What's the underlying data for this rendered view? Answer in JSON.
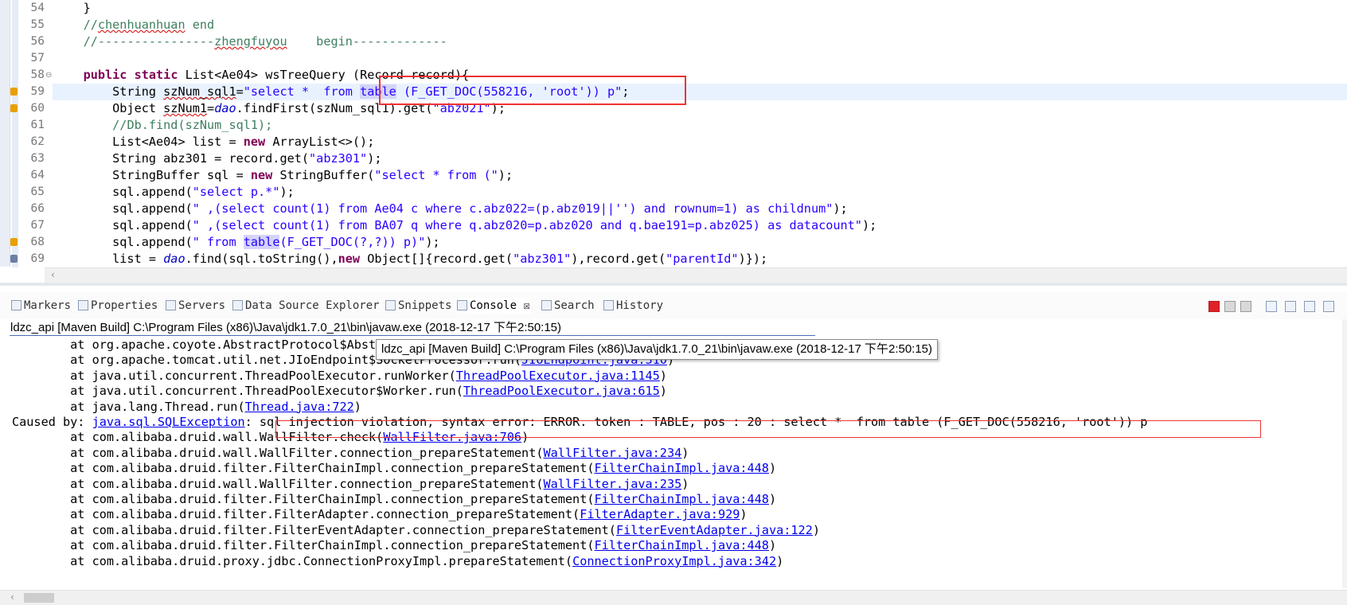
{
  "editor": {
    "lines": [
      {
        "n": "54",
        "html": "    }"
      },
      {
        "n": "55",
        "html": "    <span class=\"cmt\">//<span class=\"squig\">chenhuanhuan</span> end</span>"
      },
      {
        "n": "56",
        "html": "    <span class=\"cmt\">//----------------<span class=\"squig\">zhengfuyou</span>    begin-------------</span>"
      },
      {
        "n": "57",
        "html": ""
      },
      {
        "n": "58",
        "html": "    <span class=\"kw\">public</span> <span class=\"kw\">static</span> List&lt;Ae04&gt; wsTreeQuery (Record record){"
      },
      {
        "n": "59",
        "html": "        String <span class=\"squig\">szNum_sql1</span>=<span class=\"str\">\"select *  from <span class=\"occ\">table</span> (F_GET_DOC(558216, 'root')) p\"</span>;"
      },
      {
        "n": "60",
        "html": "        Object <span class=\"squig\">szNum1</span>=<span class=\"fld\">dao</span>.findFirst(szNum_sql1).get(<span class=\"str\">\"abz021\"</span>);"
      },
      {
        "n": "61",
        "html": "        <span class=\"cmt\">//Db.find(szNum_sql1);</span>"
      },
      {
        "n": "62",
        "html": "        List&lt;Ae04&gt; list = <span class=\"kw\">new</span> ArrayList&lt;&gt;();"
      },
      {
        "n": "63",
        "html": "        String abz301 = record.get(<span class=\"str\">\"abz301\"</span>);"
      },
      {
        "n": "64",
        "html": "        StringBuffer sql = <span class=\"kw\">new</span> StringBuffer(<span class=\"str\">\"select * from (\"</span>);"
      },
      {
        "n": "65",
        "html": "        sql.append(<span class=\"str\">\"select p.*\"</span>);"
      },
      {
        "n": "66",
        "html": "        sql.append(<span class=\"str\">\" ,(select count(1) from Ae04 c where c.abz022=(p.abz019||'') and rownum=1) as childnum\"</span>);"
      },
      {
        "n": "67",
        "html": "        sql.append(<span class=\"str\">\" ,(select count(1) from BA07 q where q.abz020=p.abz020 and q.bae191=p.abz025) as datacount\"</span>);"
      },
      {
        "n": "68",
        "html": "        sql.append(<span class=\"str\">\" from <span class=\"occ\">table</span>(F_GET_DOC(?,?)) p)\"</span>);"
      },
      {
        "n": "69",
        "html": "        list = <span class=\"fld\">dao</span>.find(sql.toString(),<span class=\"kw\">new</span> Object[]{record.get(<span class=\"str\">\"abz301\"</span>),record.get(<span class=\"str\">\"parentId\"</span>)});"
      }
    ],
    "fold_marker": "⊖",
    "scroll_left_arrow": "‹"
  },
  "tabs": [
    {
      "label": "Markers"
    },
    {
      "label": "Properties"
    },
    {
      "label": "Servers"
    },
    {
      "label": "Data Source Explorer"
    },
    {
      "label": "Snippets"
    },
    {
      "label": "Console ☒",
      "active": true
    },
    {
      "label": "Search"
    },
    {
      "label": "History"
    }
  ],
  "console": {
    "title": "ldzc_api [Maven Build] C:\\Program Files (x86)\\Java\\jdk1.7.0_21\\bin\\javaw.exe (2018-12-17 下午2:50:15)",
    "tooltip": "ldzc_api [Maven Build] C:\\Program Files (x86)\\Java\\jdk1.7.0_21\\bin\\javaw.exe (2018-12-17 下午2:50:15)",
    "lines": [
      {
        "pre": "        at org.apache.coyote.AbstractProtocol$AbstractConnectionHandler.process(",
        "link": "AbstractProtocol.java:595",
        "post": ")"
      },
      {
        "pre": "        at org.apache.tomcat.util.net.JIoEndpoint$SocketProcessor.run(",
        "link": "JIoEndpoint.java:310",
        "post": ")"
      },
      {
        "pre": "        at java.util.concurrent.ThreadPoolExecutor.runWorker(",
        "link": "ThreadPoolExecutor.java:1145",
        "post": ")"
      },
      {
        "pre": "        at java.util.concurrent.ThreadPoolExecutor$Worker.run(",
        "link": "ThreadPoolExecutor.java:615",
        "post": ")"
      },
      {
        "pre": "        at java.lang.Thread.run(",
        "link": "Thread.java:722",
        "post": ")"
      },
      {
        "pre": "Caused by: ",
        "link": "java.sql.SQLException",
        "post": ": sql injection violation, syntax error: ERROR. token : TABLE, pos : 20 : select *  from table (F_GET_DOC(558216, 'root')) p"
      },
      {
        "pre": "        at com.alibaba.druid.wall.WallFilter.check(",
        "link": "WallFilter.java:706",
        "post": ")"
      },
      {
        "pre": "        at com.alibaba.druid.wall.WallFilter.connection_prepareStatement(",
        "link": "WallFilter.java:234",
        "post": ")"
      },
      {
        "pre": "        at com.alibaba.druid.filter.FilterChainImpl.connection_prepareStatement(",
        "link": "FilterChainImpl.java:448",
        "post": ")"
      },
      {
        "pre": "        at com.alibaba.druid.wall.WallFilter.connection_prepareStatement(",
        "link": "WallFilter.java:235",
        "post": ")"
      },
      {
        "pre": "        at com.alibaba.druid.filter.FilterChainImpl.connection_prepareStatement(",
        "link": "FilterChainImpl.java:448",
        "post": ")"
      },
      {
        "pre": "        at com.alibaba.druid.filter.FilterAdapter.connection_prepareStatement(",
        "link": "FilterAdapter.java:929",
        "post": ")"
      },
      {
        "pre": "        at com.alibaba.druid.filter.FilterEventAdapter.connection_prepareStatement(",
        "link": "FilterEventAdapter.java:122",
        "post": ")"
      },
      {
        "pre": "        at com.alibaba.druid.filter.FilterChainImpl.connection_prepareStatement(",
        "link": "FilterChainImpl.java:448",
        "post": ")"
      },
      {
        "pre": "        at com.alibaba.druid.proxy.jdbc.ConnectionProxyImpl.prepareStatement(",
        "link": "ConnectionProxyImpl.java:342",
        "post": ")"
      }
    ],
    "scroll_left_arrow": "‹"
  },
  "colors": {
    "keyword": "#7f0055",
    "string": "#2a00ff",
    "comment": "#3f7f5f",
    "highlight_box": "#e33333",
    "link": "#0000ee"
  }
}
